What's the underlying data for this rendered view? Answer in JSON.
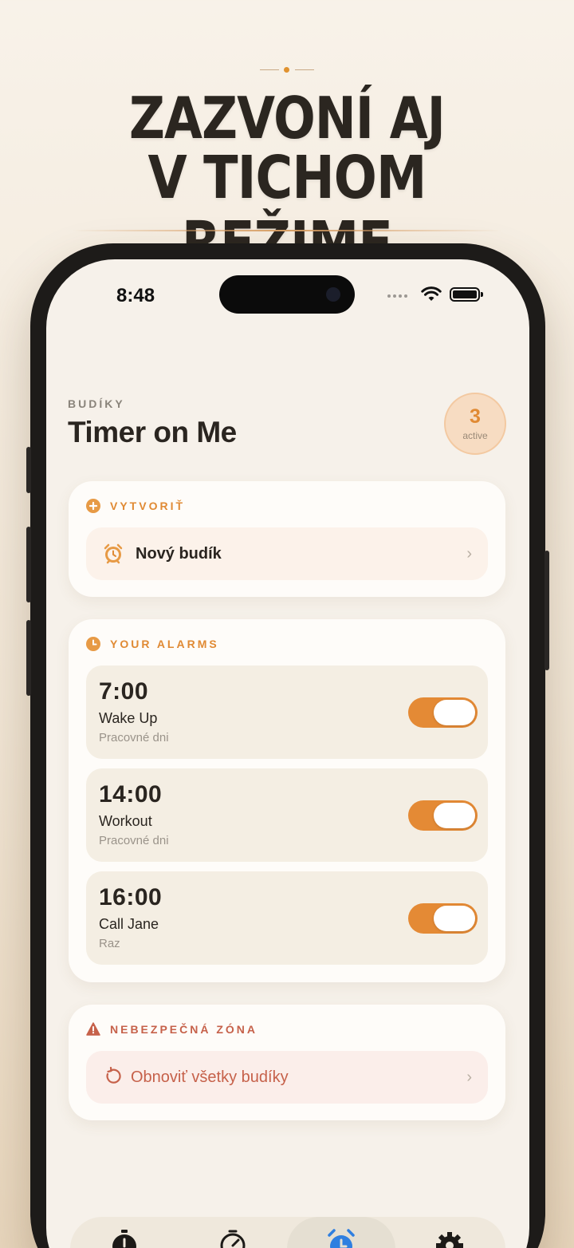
{
  "headline": {
    "line1": "ZAZVONÍ AJ",
    "line2": "V TICHOM REŽIME"
  },
  "status_bar": {
    "time": "8:48",
    "icons": [
      "signal-dots-icon",
      "wifi-icon",
      "battery-icon"
    ]
  },
  "header": {
    "eyebrow": "BUDÍKY",
    "title": "Timer on Me",
    "badge_count": "3",
    "badge_label": "active"
  },
  "create_section": {
    "label": "VYTVORIŤ",
    "icon": "plus-circle-icon",
    "new_alarm_label": "Nový budík",
    "new_alarm_icon": "alarm-clock-icon"
  },
  "alarms_section": {
    "label": "YOUR ALARMS",
    "icon": "clock-icon",
    "alarms": [
      {
        "time": "7:00",
        "name": "Wake Up",
        "repeat": "Pracovné dni",
        "enabled": true
      },
      {
        "time": "14:00",
        "name": "Workout",
        "repeat": "Pracovné dni",
        "enabled": true
      },
      {
        "time": "16:00",
        "name": "Call Jane",
        "repeat": "Raz",
        "enabled": true
      }
    ]
  },
  "danger_section": {
    "label": "NEBEZPEČNÁ ZÓNA",
    "icon": "warning-triangle-icon",
    "reset_label": "Obnoviť všetky budíky",
    "reset_icon": "reset-arrow-icon"
  },
  "tab_bar": {
    "tabs": [
      {
        "icon": "stopwatch-icon",
        "active": false
      },
      {
        "icon": "timer-icon",
        "active": false
      },
      {
        "icon": "alarm-clock-icon",
        "active": true
      },
      {
        "icon": "gear-icon",
        "active": false
      }
    ]
  },
  "colors": {
    "accent": "#e48a35",
    "danger": "#c6614a",
    "background": "#f6f1ea"
  }
}
